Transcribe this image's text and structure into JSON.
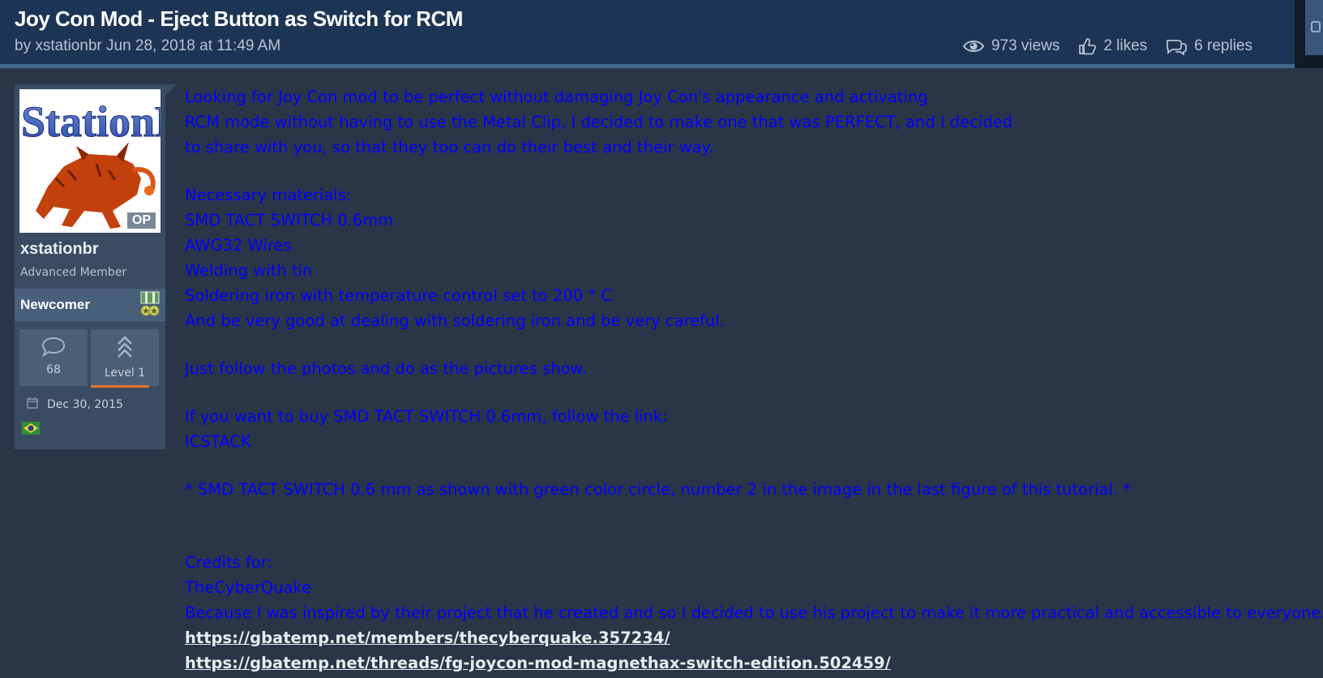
{
  "thread": {
    "title": "Joy Con Mod - Eject Button as Switch for RCM",
    "byline": "by xstationbr Jun 28, 2018 at 11:49 AM",
    "views": "973 views",
    "likes": "2 likes",
    "replies": "6 replies"
  },
  "user": {
    "avatar_text": "StationB",
    "op_badge": "OP",
    "name": "xstationbr",
    "title": "Advanced Member",
    "rank": "Newcomer",
    "messages": "68",
    "level": "Level 1",
    "level_progress": 1.0,
    "joined": "Dec 30, 2015"
  },
  "post": {
    "intro": [
      "Looking for Joy Con mod to be perfect without damaging Joy Con's appearance and activating",
      "RCM mode without having to use the Metal Clip, I decided to make one that was PERFECT, and I decided",
      "to share with you, so that they too can do their best and their way."
    ],
    "materials_heading": "Necessary materials:",
    "materials": [
      "SMD TACT SWITCH 0.6mm",
      "AWG32 Wires",
      "Welding with tin",
      "Soldering iron with temperature control set to 200 ° C",
      "And be very good at dealing with soldering iron and be very careful."
    ],
    "instructions": "Just follow the photos and do as the pictures show.",
    "buy_text": "If you want to buy SMD TACT SWITCH 0.6mm, follow the link:",
    "buy_link": "ICSTACK",
    "note": "* SMD TACT SWITCH 0.6 mm as shown with green color circle, number 2 in the image in the last figure of this tutorial. *",
    "credits_heading": "Credits for:",
    "credits_name": "TheCyberQuake",
    "credits_text": "Because I was inspired by their project that he created and so I decided to use his project to make it more practical and accessible to everyone.",
    "links": [
      "https://gbatemp.net/members/thecyberquake.357234/",
      "https://gbatemp.net/threads/fg-joycon-mod-magnethax-switch-edition.502459/"
    ]
  },
  "colors": {
    "header_bg": "#1d3555",
    "page_bg": "#2a3647",
    "post_text": "#0000ff",
    "level_bar": "#e6742b"
  },
  "icons": [
    "eye-icon",
    "thumbs-up-icon",
    "speech-bubbles-icon",
    "comment-icon",
    "chevrons-up-icon",
    "calendar-icon",
    "medal-icon",
    "brazil-flag-icon"
  ]
}
